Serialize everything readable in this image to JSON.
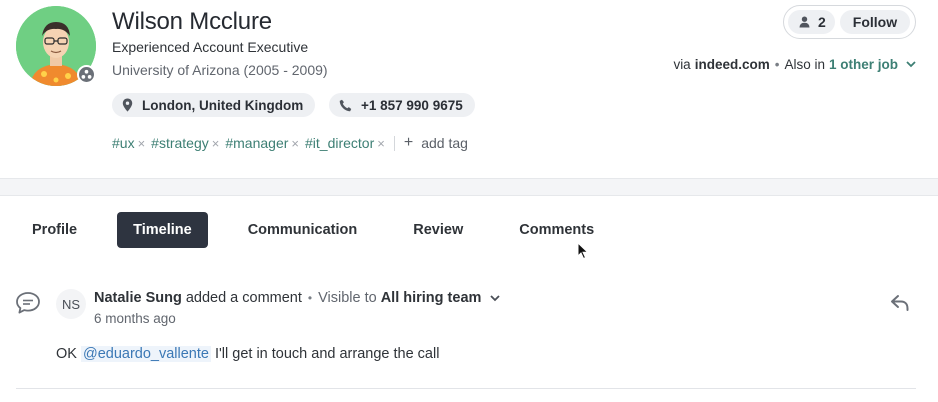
{
  "profile": {
    "name": "Wilson Mcclure",
    "job_title": "Experienced Account Executive",
    "education": "University of Arizona (2005 - 2009)",
    "location": "London, United Kingdom",
    "phone": "+1 857 990 9675",
    "tags": [
      {
        "label": "#ux"
      },
      {
        "label": "#strategy"
      },
      {
        "label": "#manager"
      },
      {
        "label": "#it_director"
      }
    ],
    "remove_glyph": "×",
    "add_tag_label": "add tag",
    "add_tag_glyph": "+"
  },
  "header_actions": {
    "follower_count": "2",
    "follow_label": "Follow"
  },
  "source": {
    "via_label": "via",
    "site": "indeed.com",
    "separator": "•",
    "also_in_label": "Also in",
    "other_job_link": "1 other job"
  },
  "tabs": [
    {
      "label": "Profile",
      "active": false
    },
    {
      "label": "Timeline",
      "active": true
    },
    {
      "label": "Communication",
      "active": false
    },
    {
      "label": "Review",
      "active": false
    },
    {
      "label": "Comments",
      "active": false
    }
  ],
  "comment": {
    "initials": "NS",
    "author": "Natalie Sung",
    "action": "added a comment",
    "separator": "•",
    "visibility_label": "Visible to",
    "visibility_value": "All hiring team",
    "time": "6 months ago",
    "body_prefix": "OK",
    "mention": "@eduardo_vallente",
    "body_suffix": "I'll get in touch and arrange the call"
  },
  "icons": {
    "avatar_badge": "team-badge-icon",
    "location": "map-pin-icon",
    "phone": "phone-icon",
    "followers": "user-icon",
    "dropdown": "chevron-down-icon",
    "comment": "speech-bubble-icon",
    "reply": "reply-arrow-icon"
  },
  "colors": {
    "accent_green": "#3d7f74",
    "mention_blue": "#3b78b5",
    "active_tab": "#2e3440"
  }
}
